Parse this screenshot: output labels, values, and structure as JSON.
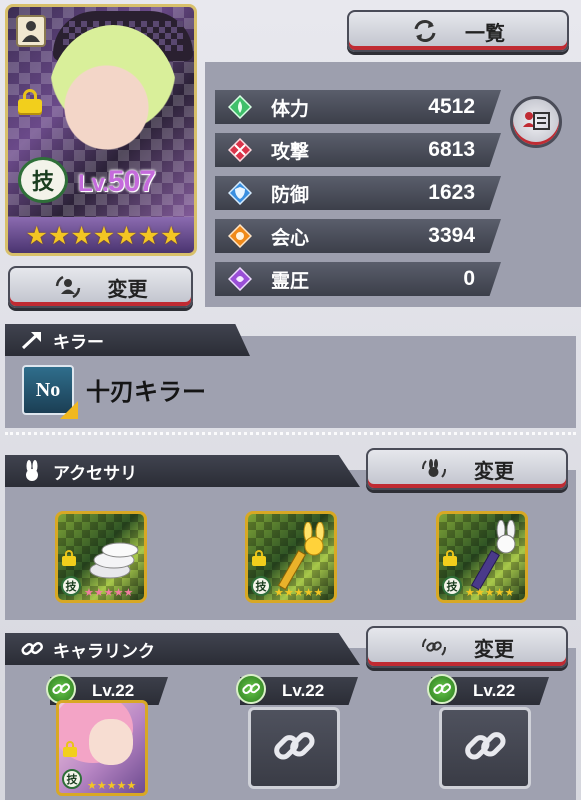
{
  "character": {
    "level_prefix": "Lv.",
    "level": "507",
    "skill_glyph": "技",
    "stars": [
      "★",
      "★",
      "★",
      "★",
      "★",
      "★",
      "★"
    ]
  },
  "buttons": {
    "list_label": "一覧",
    "change_label": "変更"
  },
  "stats": [
    {
      "label": "体力",
      "value": "4512",
      "color": "#3fbf6a",
      "icon": "hp-gem-icon"
    },
    {
      "label": "攻撃",
      "value": "6813",
      "color": "#d9344a",
      "icon": "attack-gem-icon"
    },
    {
      "label": "防御",
      "value": "1623",
      "color": "#3a8fe0",
      "icon": "defense-gem-icon"
    },
    {
      "label": "会心",
      "value": "3394",
      "color": "#f08a1a",
      "icon": "critical-gem-icon"
    },
    {
      "label": "霊圧",
      "value": "0",
      "color": "#9a4fd6",
      "icon": "spirit-gem-icon"
    }
  ],
  "killer": {
    "header": "キラー",
    "icon_text": "No",
    "text": "十刃キラー"
  },
  "accessory": {
    "header": "アクセサリ",
    "change_label": "変更",
    "items": [
      {
        "stars": [
          "★",
          "★",
          "★",
          "★",
          "★"
        ],
        "star_color": "#f07fa0",
        "icon": "coins-icon"
      },
      {
        "stars": [
          "★",
          "★",
          "★",
          "★",
          "★"
        ],
        "star_color": "#f3c623",
        "icon": "rabbit-staff-icon"
      },
      {
        "stars": [
          "★",
          "★",
          "★",
          "★",
          "★"
        ],
        "star_color": "#f3c623",
        "icon": "rabbit-pen-icon"
      }
    ]
  },
  "chara_link": {
    "header": "キャラリンク",
    "change_label": "変更",
    "slots": [
      {
        "level": "Lv.22",
        "filled": true
      },
      {
        "level": "Lv.22",
        "filled": false
      },
      {
        "level": "Lv.22",
        "filled": false
      }
    ]
  }
}
